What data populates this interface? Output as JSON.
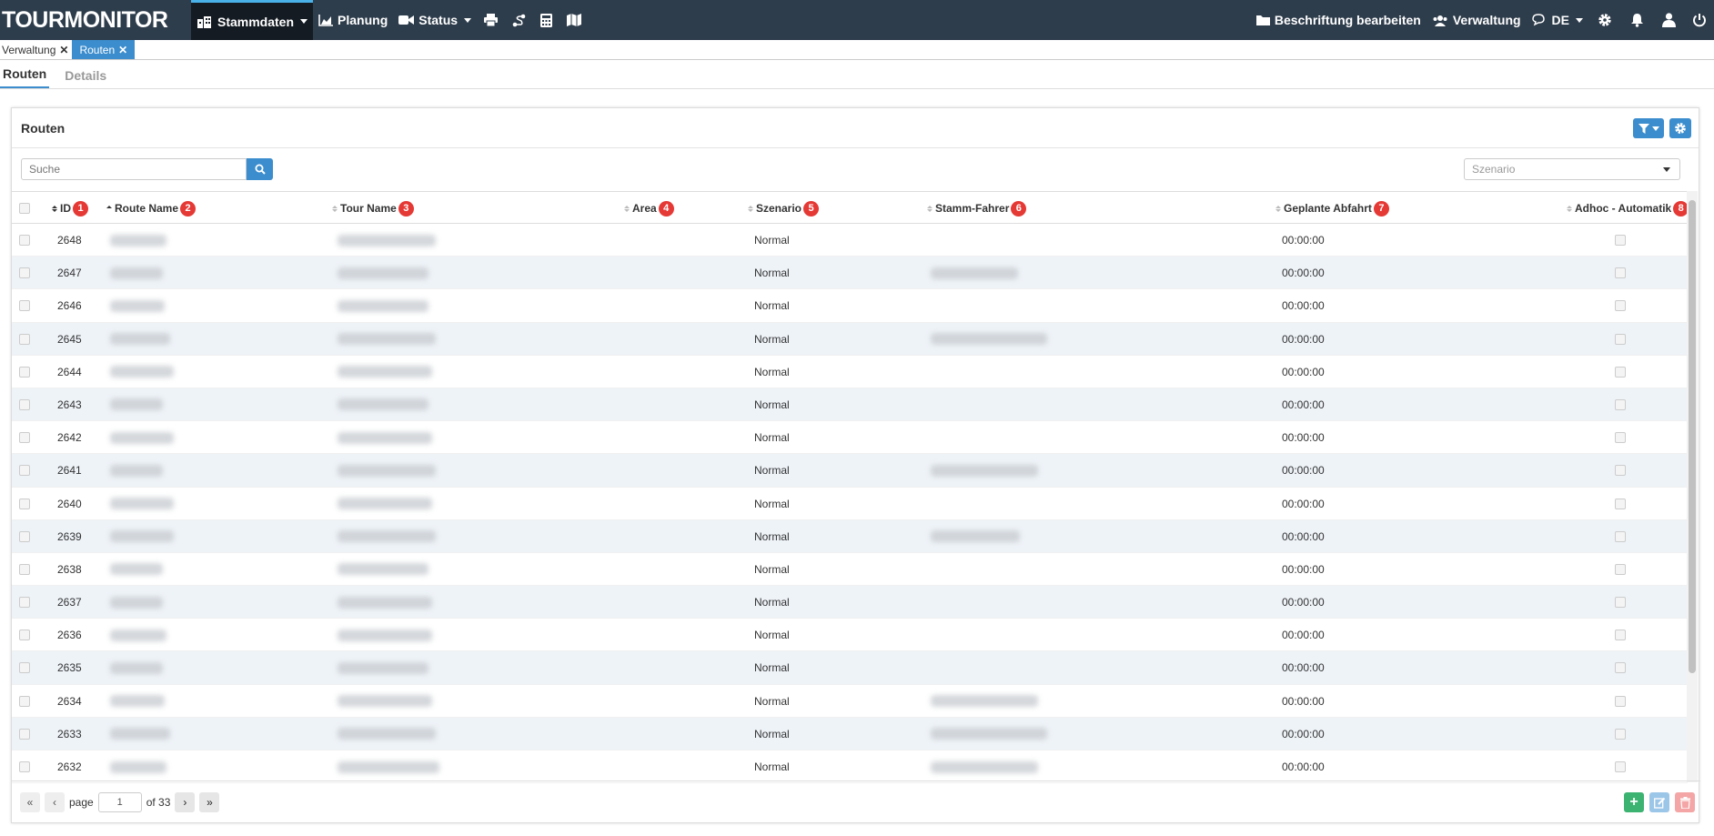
{
  "app": {
    "logo": "TOURMONITOR"
  },
  "nav": {
    "stammdaten": "Stammdaten",
    "planung": "Planung",
    "status": "Status",
    "beschriftung": "Beschriftung bearbeiten",
    "verwaltung": "Verwaltung",
    "language": "DE"
  },
  "tabs": [
    {
      "label": "Verwaltung",
      "active": false
    },
    {
      "label": "Routen",
      "active": true
    }
  ],
  "subtabs": [
    {
      "label": "Routen",
      "active": true
    },
    {
      "label": "Details",
      "active": false
    }
  ],
  "panel": {
    "title": "Routen",
    "search_placeholder": "Suche",
    "scenario_placeholder": "Szenario"
  },
  "columns": [
    {
      "label": "ID",
      "badge": "1"
    },
    {
      "label": "Route Name",
      "badge": "2"
    },
    {
      "label": "Tour Name",
      "badge": "3"
    },
    {
      "label": "Area",
      "badge": "4"
    },
    {
      "label": "Szenario",
      "badge": "5"
    },
    {
      "label": "Stamm-Fahrer",
      "badge": "6"
    },
    {
      "label": "Geplante Abfahrt",
      "badge": "7"
    },
    {
      "label": "Adhoc - Automatik",
      "badge": "8"
    }
  ],
  "rows": [
    {
      "id": "2648",
      "szenario": "Normal",
      "abfahrt": "00:00:00",
      "driver_blur": false
    },
    {
      "id": "2647",
      "szenario": "Normal",
      "abfahrt": "00:00:00",
      "driver_blur": true
    },
    {
      "id": "2646",
      "szenario": "Normal",
      "abfahrt": "00:00:00",
      "driver_blur": false
    },
    {
      "id": "2645",
      "szenario": "Normal",
      "abfahrt": "00:00:00",
      "driver_blur": true
    },
    {
      "id": "2644",
      "szenario": "Normal",
      "abfahrt": "00:00:00",
      "driver_blur": false
    },
    {
      "id": "2643",
      "szenario": "Normal",
      "abfahrt": "00:00:00",
      "driver_blur": false
    },
    {
      "id": "2642",
      "szenario": "Normal",
      "abfahrt": "00:00:00",
      "driver_blur": false
    },
    {
      "id": "2641",
      "szenario": "Normal",
      "abfahrt": "00:00:00",
      "driver_blur": true
    },
    {
      "id": "2640",
      "szenario": "Normal",
      "abfahrt": "00:00:00",
      "driver_blur": false
    },
    {
      "id": "2639",
      "szenario": "Normal",
      "abfahrt": "00:00:00",
      "driver_blur": true
    },
    {
      "id": "2638",
      "szenario": "Normal",
      "abfahrt": "00:00:00",
      "driver_blur": false
    },
    {
      "id": "2637",
      "szenario": "Normal",
      "abfahrt": "00:00:00",
      "driver_blur": false
    },
    {
      "id": "2636",
      "szenario": "Normal",
      "abfahrt": "00:00:00",
      "driver_blur": false
    },
    {
      "id": "2635",
      "szenario": "Normal",
      "abfahrt": "00:00:00",
      "driver_blur": false
    },
    {
      "id": "2634",
      "szenario": "Normal",
      "abfahrt": "00:00:00",
      "driver_blur": true
    },
    {
      "id": "2633",
      "szenario": "Normal",
      "abfahrt": "00:00:00",
      "driver_blur": true
    },
    {
      "id": "2632",
      "szenario": "Normal",
      "abfahrt": "00:00:00",
      "driver_blur": true
    }
  ],
  "pager": {
    "page_label": "page",
    "page_value": "1",
    "of_label": "of 33"
  },
  "colors": {
    "topbar": "#2e3d4c",
    "accent": "#3c8dcd",
    "badge": "#e53935",
    "add": "#3cb371",
    "delete": "#f4a6a6"
  }
}
